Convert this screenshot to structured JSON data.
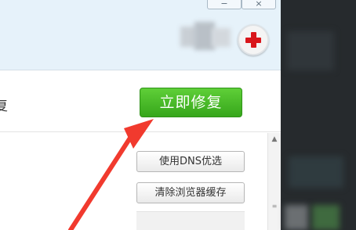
{
  "window": {
    "controls": {
      "minimize_label": "−",
      "close_label": "×"
    },
    "header_icon": "red-cross-icon"
  },
  "main": {
    "truncated_text": "复",
    "repair_button_label": "立即修复",
    "dns_button_label": "使用DNS优选",
    "clear_cache_button_label": "清除浏览器缓存",
    "scroll_up_glyph": "▲"
  },
  "colors": {
    "header_bg": "#e6f2fa",
    "primary_green": "#3fb424",
    "red_cross": "#d9161b",
    "arrow_red": "#f13a2e",
    "dark_side": "#262a2d"
  }
}
